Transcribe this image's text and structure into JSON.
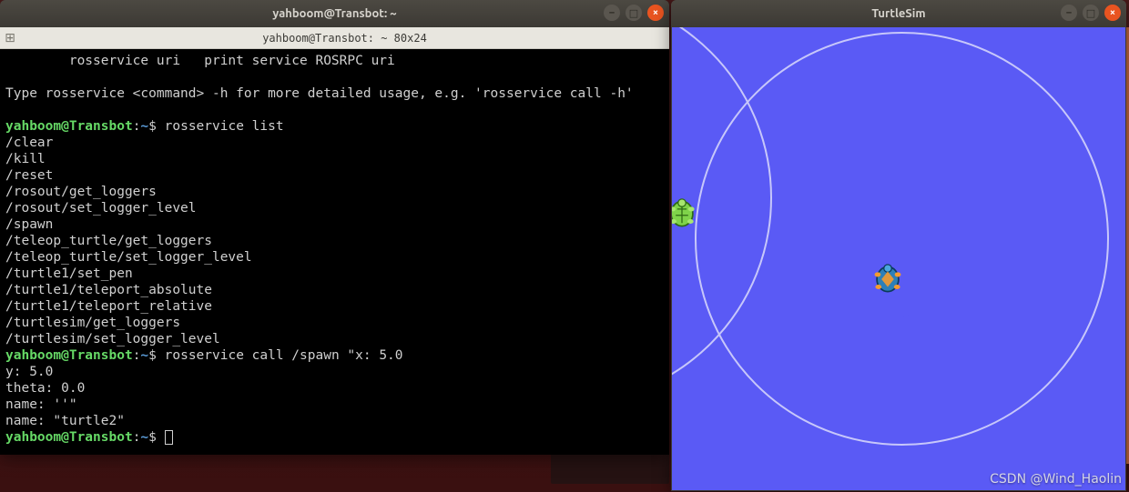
{
  "terminal": {
    "title": "yahboom@Transbot: ~",
    "subtitle": "yahboom@Transbot: ~ 80x24",
    "controls": {
      "min": "–",
      "max": "□",
      "close": "×"
    },
    "lines": {
      "l0": "        rosservice uri   print service ROSRPC uri",
      "l1": "",
      "l2": "Type rosservice <command> -h for more detailed usage, e.g. 'rosservice call -h'",
      "l3": "",
      "p1_user": "yahboom@Transbot",
      "p1_colon": ":",
      "p1_path": "~",
      "p1_dollar": "$ ",
      "cmd1": "rosservice list",
      "s0": "/clear",
      "s1": "/kill",
      "s2": "/reset",
      "s3": "/rosout/get_loggers",
      "s4": "/rosout/set_logger_level",
      "s5": "/spawn",
      "s6": "/teleop_turtle/get_loggers",
      "s7": "/teleop_turtle/set_logger_level",
      "s8": "/turtle1/set_pen",
      "s9": "/turtle1/teleport_absolute",
      "s10": "/turtle1/teleport_relative",
      "s11": "/turtlesim/get_loggers",
      "s12": "/turtlesim/set_logger_level",
      "cmd2": "rosservice call /spawn \"x: 5.0",
      "r0": "y: 5.0",
      "r1": "theta: 0.0",
      "r2": "name: ''\"",
      "r3": "name: \"turtle2\""
    }
  },
  "turtlesim": {
    "title": "TurtleSim",
    "controls": {
      "min": "–",
      "max": "□",
      "close": "×"
    }
  },
  "watermark": "CSDN @Wind_Haolin"
}
